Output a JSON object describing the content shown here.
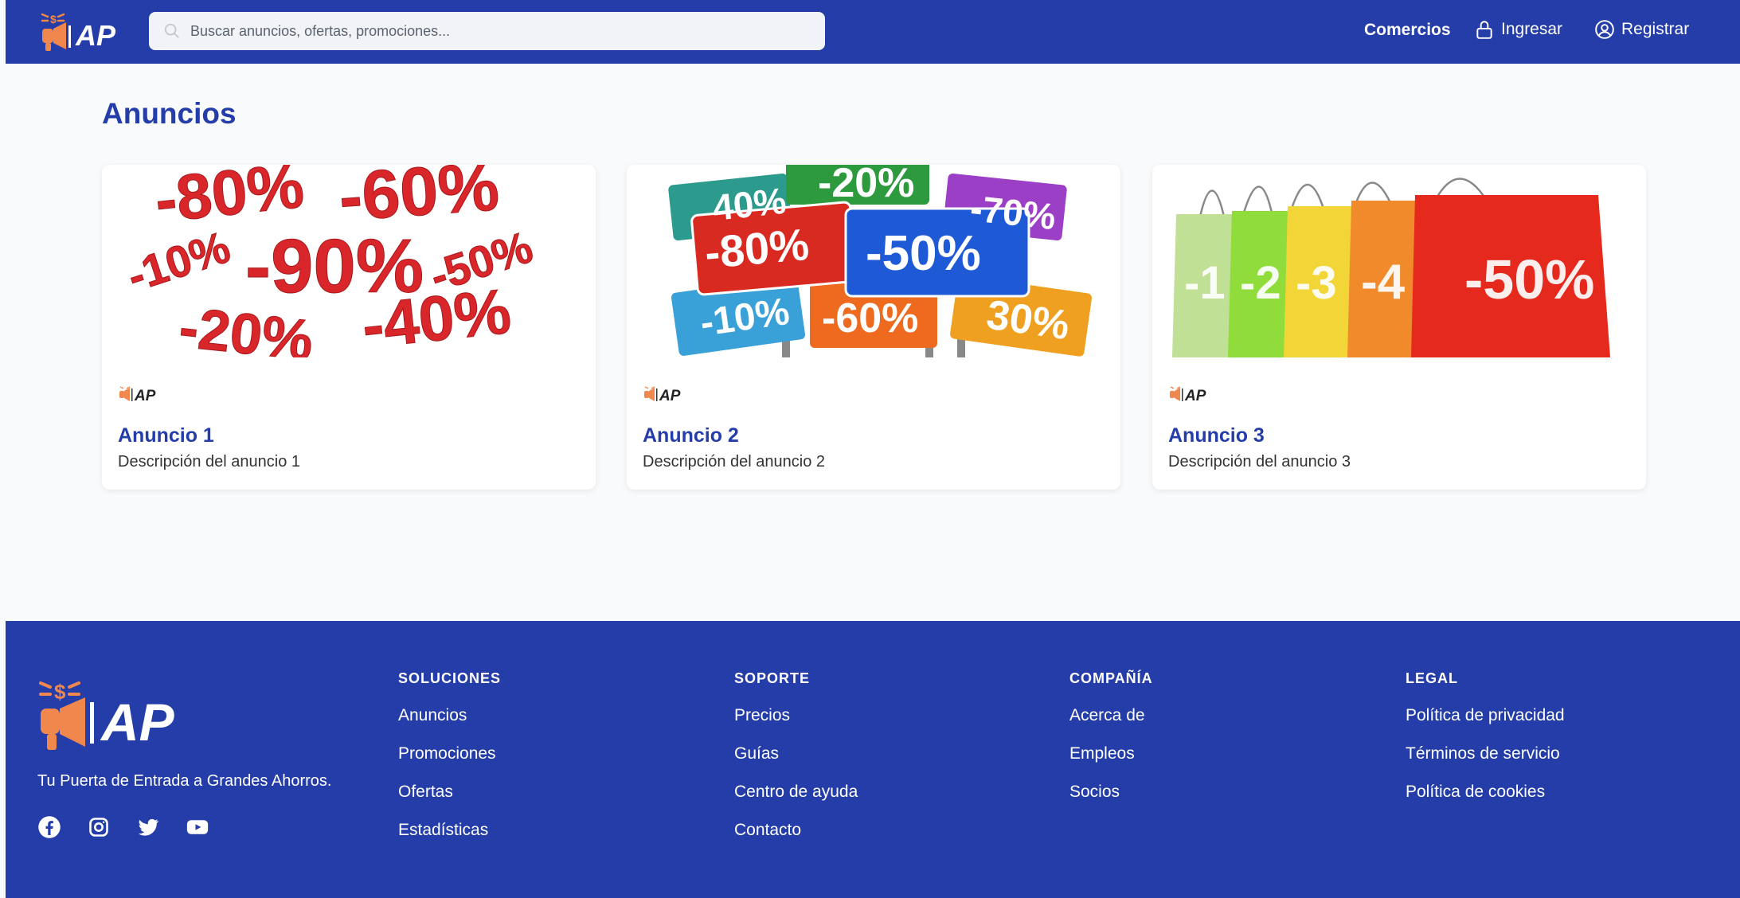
{
  "header": {
    "logo_text": "AP",
    "search_placeholder": "Buscar anuncios, ofertas, promociones...",
    "nav": {
      "stores": "Comercios",
      "login": "Ingresar",
      "register": "Registrar"
    }
  },
  "main": {
    "title": "Anuncios",
    "cards": [
      {
        "title": "Anuncio 1",
        "description": "Descripción del anuncio 1",
        "badge_text": "AP"
      },
      {
        "title": "Anuncio 2",
        "description": "Descripción del anuncio 2",
        "badge_text": "AP"
      },
      {
        "title": "Anuncio 3",
        "description": "Descripción del anuncio 3",
        "badge_text": "AP"
      }
    ],
    "card1_image_text": [
      "-80%",
      "-60%",
      "-10%",
      "-90%",
      "-50%",
      "-20%",
      "-40%"
    ],
    "card2_image_text": [
      "-20%",
      "40%",
      "-70%",
      "-80%",
      "-50%",
      "-10%",
      "-60%",
      "30%"
    ],
    "card3_image_text": [
      "-1",
      "-2",
      "-3",
      "-4",
      "-50%"
    ]
  },
  "footer": {
    "logo_text": "AP",
    "tagline": "Tu Puerta de Entrada a Grandes Ahorros.",
    "socials": [
      "facebook-icon",
      "instagram-icon",
      "twitter-icon",
      "youtube-icon"
    ],
    "columns": [
      {
        "heading": "SOLUCIONES",
        "links": [
          "Anuncios",
          "Promociones",
          "Ofertas",
          "Estadísticas"
        ]
      },
      {
        "heading": "SOPORTE",
        "links": [
          "Precios",
          "Guías",
          "Centro de ayuda",
          "Contacto"
        ]
      },
      {
        "heading": "COMPAÑÍA",
        "links": [
          "Acerca de",
          "Empleos",
          "Socios"
        ]
      },
      {
        "heading": "LEGAL",
        "links": [
          "Política de privacidad",
          "Términos de servicio",
          "Política de cookies"
        ]
      }
    ]
  },
  "colors": {
    "primary": "#253da8",
    "accent": "#f0874d",
    "background": "#f8fafc"
  }
}
